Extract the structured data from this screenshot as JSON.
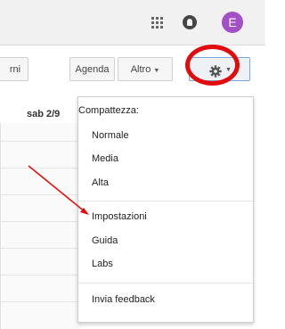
{
  "header": {
    "avatar_letter": "E",
    "avatar_color": "#a34fc6",
    "icons": [
      "apps-grid-icon",
      "notifications-icon"
    ]
  },
  "toolbar": {
    "giorni_label": "rni",
    "agenda_label": "Agenda",
    "altro_label": "Altro",
    "settings_icon": "gear-icon"
  },
  "calendar": {
    "day_label": "sab 2/9"
  },
  "menu": {
    "section_title": "Compattezza:",
    "density_options": [
      "Normale",
      "Media",
      "Alta"
    ],
    "items": [
      "Impostazioni",
      "Guida",
      "Labs"
    ],
    "feedback_label": "Invia feedback"
  },
  "annotation": {
    "circle_color": "#e20c0c",
    "arrow_color": "#e20c0c"
  }
}
